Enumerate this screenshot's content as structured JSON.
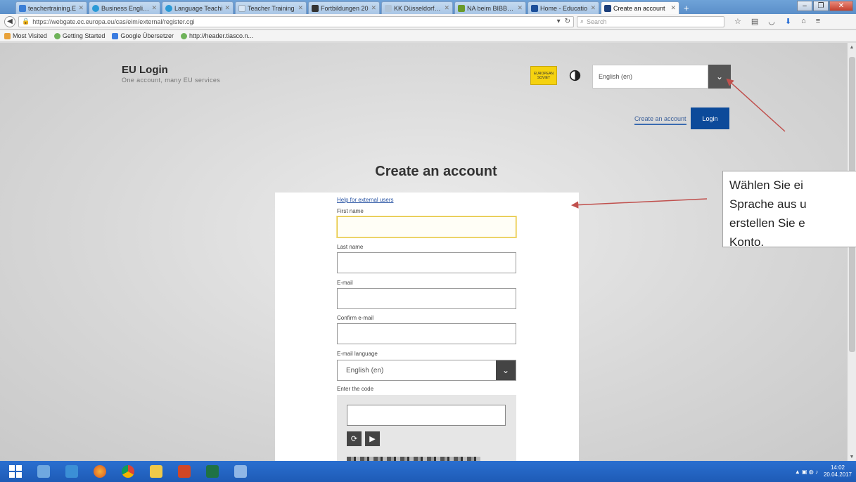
{
  "browser": {
    "tabs": [
      {
        "label": "teachertraining.E",
        "color": "#3a7ed6"
      },
      {
        "label": "Business English -",
        "color": "#2a9ad6"
      },
      {
        "label": "Language Teachi",
        "color": "#2a9ad6"
      },
      {
        "label": "Teacher Training",
        "color": "#d8e6f4"
      },
      {
        "label": "Fortbildungen 20",
        "color": "#333333"
      },
      {
        "label": "KK Düsseldorf - F",
        "color": "#b0c4d8"
      },
      {
        "label": "NA beim BIBB: Pr",
        "color": "#6a9a2a"
      },
      {
        "label": "Home - Educatio",
        "color": "#1c4f9a"
      },
      {
        "label": "Create an account",
        "color": "#1c3f7a"
      }
    ],
    "new_tab": "+",
    "url": "https://webgate.ec.europa.eu/cas/eim/external/register.cgi",
    "search_placeholder": "Search",
    "bookmarks": [
      "Most Visited",
      "Getting Started",
      "Google Übersetzer",
      "http://header.tiasco.n..."
    ]
  },
  "page": {
    "brand_title": "EU Login",
    "brand_subtitle": "One account, many EU services",
    "eu_badge_line1": "EUROPEAN",
    "eu_badge_line2": "SOVIET",
    "language_value": "English (en)",
    "create_link": "Create an account",
    "login_button": "Login",
    "title": "Create an account",
    "form": {
      "help_link": "Help for external users",
      "first_name_label": "First name",
      "last_name_label": "Last name",
      "email_label": "E-mail",
      "confirm_email_label": "Confirm e-mail",
      "email_language_label": "E-mail language",
      "email_language_value": "English (en)",
      "code_label": "Enter the code"
    }
  },
  "annotation": {
    "line1": "Wählen Sie ei",
    "line2": "Sprache aus u",
    "line3": "erstellen Sie e",
    "line4": "Konto.",
    "arrow_color": "#c0504d"
  },
  "taskbar": {
    "time": "14:02",
    "date": "20.04.2017"
  }
}
